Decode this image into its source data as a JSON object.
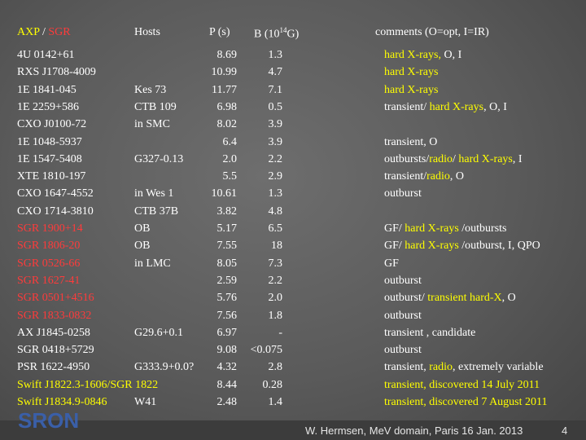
{
  "header": {
    "axp": "AXP",
    "slash": " / ",
    "sgr": "SGR",
    "hosts": "Hosts",
    "period": "P (s)",
    "b_field_pre": "B (10",
    "b_field_sup": "14",
    "b_field_post": "G)",
    "comments": "comments  (O=opt, I=IR)"
  },
  "rows": [
    {
      "name": "4U 0142+61",
      "host": "",
      "p": "8.69",
      "b": "1.3",
      "comment": [
        [
          "hard X-rays, ",
          "y"
        ],
        [
          "O, I",
          "w"
        ]
      ],
      "ncolor": "w"
    },
    {
      "name": "RXS J1708-4009",
      "host": "",
      "p": "10.99",
      "b": "4.7",
      "comment": [
        [
          "hard X-rays",
          "y"
        ]
      ],
      "ncolor": "w"
    },
    {
      "name": "1E 1841-045",
      "host": "Kes 73",
      "p": "11.77",
      "b": "7.1",
      "comment": [
        [
          "hard X-rays",
          "y"
        ]
      ],
      "ncolor": "w"
    },
    {
      "name": "1E 2259+586",
      "host": "CTB 109",
      "p": "6.98",
      "b": "0.5",
      "comment": [
        [
          "transient/ ",
          "w"
        ],
        [
          "hard X-rays",
          "y"
        ],
        [
          ", O, I",
          "w"
        ]
      ],
      "ncolor": "w"
    },
    {
      "name": "CXO J0100-72",
      "host": "in SMC",
      "p": "8.02",
      "b": "3.9",
      "comment": [],
      "ncolor": "w"
    },
    {
      "name": "1E 1048-5937",
      "host": "",
      "p": "6.4",
      "b": "3.9",
      "comment": [
        [
          "transient, O",
          "w"
        ]
      ],
      "ncolor": "w"
    },
    {
      "name": "1E 1547-5408",
      "host": "G327-0.13",
      "p": "2.0",
      "b": "2.2",
      "comment": [
        [
          "outbursts/",
          "w"
        ],
        [
          "radio",
          "y"
        ],
        [
          "/ ",
          "w"
        ],
        [
          "hard X-rays",
          "y"
        ],
        [
          ", I",
          "w"
        ]
      ],
      "ncolor": "w"
    },
    {
      "name": "XTE 1810-197",
      "host": "",
      "p": "5.5",
      "b": "2.9",
      "comment": [
        [
          "transient/",
          "w"
        ],
        [
          "radio",
          "y"
        ],
        [
          ", O",
          "w"
        ]
      ],
      "ncolor": "w"
    },
    {
      "name": "CXO 1647-4552",
      "host": "in Wes 1",
      "p": "10.61",
      "b": "1.3",
      "comment": [
        [
          "outburst",
          "w"
        ]
      ],
      "ncolor": "w"
    },
    {
      "name": "CXO 1714-3810",
      "host": "CTB 37B",
      "p": "3.82",
      "b": "4.8",
      "comment": [],
      "ncolor": "w"
    },
    {
      "name": "SGR 1900+14",
      "host": "OB",
      "p": "5.17",
      "b": "6.5",
      "comment": [
        [
          "GF/ ",
          "w"
        ],
        [
          "hard X-rays",
          "y"
        ],
        [
          " /outbursts",
          "w"
        ]
      ],
      "ncolor": "r"
    },
    {
      "name": "SGR 1806-20",
      "host": "OB",
      "p": "7.55",
      "b": "18",
      "comment": [
        [
          "GF/ ",
          "w"
        ],
        [
          "hard X-rays",
          "y"
        ],
        [
          " /outburst, I, QPO",
          "w"
        ]
      ],
      "ncolor": "r"
    },
    {
      "name": "SGR 0526-66",
      "host": "in LMC",
      "p": "8.05",
      "b": "7.3",
      "comment": [
        [
          "GF",
          "w"
        ]
      ],
      "ncolor": "r"
    },
    {
      "name": "SGR 1627-41",
      "host": "",
      "p": "2.59",
      "b": "2.2",
      "comment": [
        [
          "outburst",
          "w"
        ]
      ],
      "ncolor": "r"
    },
    {
      "name": "SGR 0501+4516",
      "host": "",
      "p": "5.76",
      "b": "2.0",
      "comment": [
        [
          "outburst/ ",
          "w"
        ],
        [
          "transient hard-X",
          "y"
        ],
        [
          ", O",
          "w"
        ]
      ],
      "ncolor": "r"
    },
    {
      "name": "SGR 1833-0832",
      "host": "",
      "p": "7.56",
      "b": "1.8",
      "comment": [
        [
          "outburst",
          "w"
        ]
      ],
      "ncolor": "r"
    },
    {
      "name": "AX J1845-0258",
      "host": "G29.6+0.1",
      "p": "6.97",
      "b": "-",
      "comment": [
        [
          "transient , candidate",
          "w"
        ]
      ],
      "ncolor": "w"
    },
    {
      "name": "SGR 0418+5729",
      "host": "",
      "p": "9.08",
      "b": "<0.075",
      "comment": [
        [
          "outburst",
          "w"
        ]
      ],
      "ncolor": "w"
    },
    {
      "name": "PSR 1622-4950",
      "host": "G333.9+0.0?",
      "p": "4.32",
      "b": "2.8",
      "comment": [
        [
          "transient, ",
          "w"
        ],
        [
          "radio",
          "y"
        ],
        [
          ", extremely variable",
          "w"
        ]
      ],
      "ncolor": "w"
    },
    {
      "name": "Swift J1822.3-1606/SGR 1822",
      "host": "",
      "p": "8.44",
      "b": "0.28",
      "comment": [
        [
          "transient, discovered 14 July 2011",
          "y"
        ]
      ],
      "ncolor": "y"
    },
    {
      "name": "Swift J1834.9-0846",
      "host": "W41",
      "p": "2.48",
      "b": "1.4",
      "comment": [
        [
          "transient, discovered 7 August 2011",
          "y"
        ]
      ],
      "ncolor": "y"
    }
  ],
  "logo_text": "SRON",
  "footer": {
    "credit": "W. Hermsen, MeV domain, Paris 16 Jan. 2013",
    "page": "4"
  },
  "colors": {
    "white": "#ffffff",
    "yellow": "#ffff00",
    "red": "#ff3b3b",
    "logo_blue": "#3a5fa8"
  }
}
